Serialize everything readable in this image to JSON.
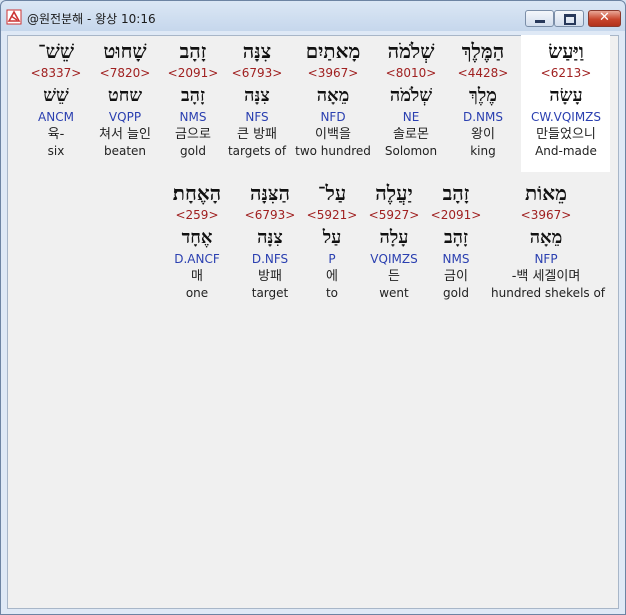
{
  "window": {
    "title": "@원전분해 - 왕상 10:16"
  },
  "controls": {
    "close_glyph": "✕"
  },
  "row1": [
    {
      "heb": "וַיַּעַשׂ",
      "strong": "<6213>",
      "lemma": "עָשָׂה",
      "morph": "CW.VQIMZS",
      "kor": "만들었으니",
      "eng": "And-made"
    },
    {
      "heb": "הַמֶּלֶךְ",
      "strong": "<4428>",
      "lemma": "מֶלֶךְ",
      "morph": "D.NMS",
      "kor": "왕이",
      "eng": "king"
    },
    {
      "heb": "שְׁלֹמֹה",
      "strong": "<8010>",
      "lemma": "שְׁלֹמֹה",
      "morph": "NE",
      "kor": "솔로몬",
      "eng": "Solomon"
    },
    {
      "heb": "מָאתַיִם",
      "strong": "<3967>",
      "lemma": "מֵאָה",
      "morph": "NFD",
      "kor": "이백을",
      "eng": "two hundred"
    },
    {
      "heb": "צִנָּה",
      "strong": "<6793>",
      "lemma": "צִנָּה",
      "morph": "NFS",
      "kor": "큰 방패",
      "eng": "targets of"
    },
    {
      "heb": "זָהָב",
      "strong": "<2091>",
      "lemma": "זָהָב",
      "morph": "NMS",
      "kor": "금으로",
      "eng": "gold"
    },
    {
      "heb": "שָׁחוּט",
      "strong": "<7820>",
      "lemma": "שחט",
      "morph": "VQPP",
      "kor": "쳐서 늘인",
      "eng": "beaten"
    },
    {
      "heb": "שֵׁשׁ־",
      "strong": "<8337>",
      "lemma": "שֵׁשׁ",
      "morph": "ANCM",
      "kor": "육-",
      "eng": "six"
    }
  ],
  "row2": [
    {
      "heb": "מֵאוֹת",
      "strong": "<3967>",
      "lemma": "מֵאָה",
      "morph": "NFP",
      "kor": "-백 세겔이며",
      "eng": "hundred shekels of"
    },
    {
      "heb": "זָהָב",
      "strong": "<2091>",
      "lemma": "זָהָב",
      "morph": "NMS",
      "kor": "금이",
      "eng": "gold"
    },
    {
      "heb": "יַעֲלֶה",
      "strong": "<5927>",
      "lemma": "עָלָה",
      "morph": "VQIMZS",
      "kor": "든",
      "eng": "went"
    },
    {
      "heb": "עַל־",
      "strong": "<5921>",
      "lemma": "עַל",
      "morph": "P",
      "kor": "에",
      "eng": "to"
    },
    {
      "heb": "הַצִּנָּה",
      "strong": "<6793>",
      "lemma": "צִנָּה",
      "morph": "D.NFS",
      "kor": "방패",
      "eng": "target"
    },
    {
      "heb": "הָאֶחָת׃",
      "strong": "<259>",
      "lemma": "אֶחָד",
      "morph": "D.ANCF",
      "kor": "매",
      "eng": "one"
    }
  ]
}
